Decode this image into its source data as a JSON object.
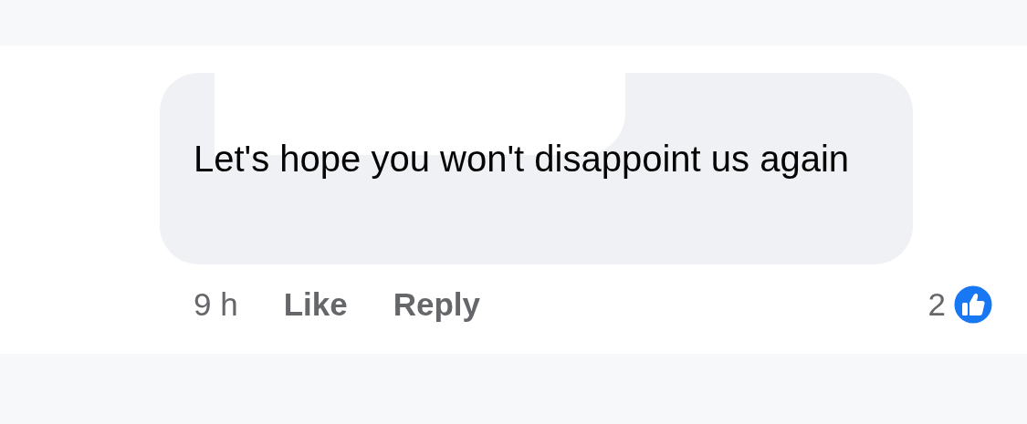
{
  "comment": {
    "text": "Let's hope you won't disappoint us again",
    "time": "9 h",
    "actions": [
      "Like",
      "Reply"
    ],
    "reaction_count": "2"
  }
}
